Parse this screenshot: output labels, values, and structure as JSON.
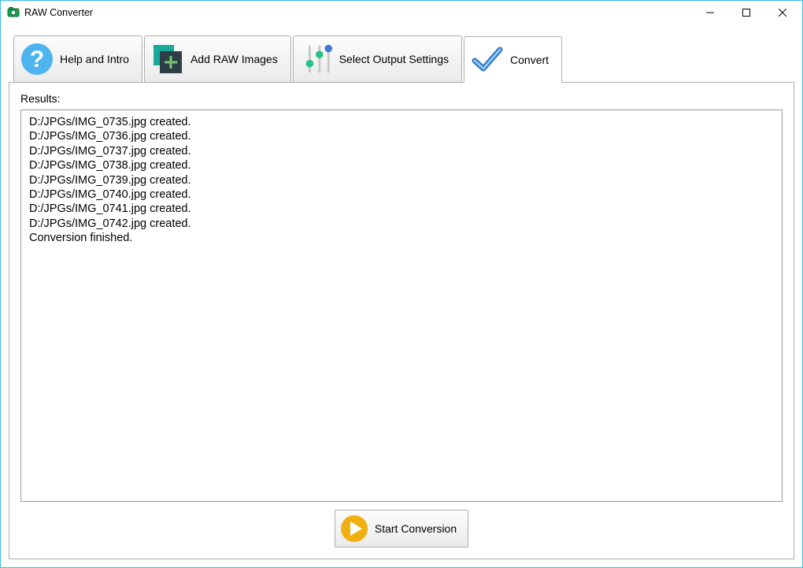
{
  "window": {
    "title": "RAW Converter"
  },
  "tabs": [
    {
      "label": "Help and Intro"
    },
    {
      "label": "Add RAW Images"
    },
    {
      "label": "Select Output Settings"
    },
    {
      "label": "Convert"
    }
  ],
  "results": {
    "label": "Results:",
    "text": "D:/JPGs/IMG_0735.jpg created.\nD:/JPGs/IMG_0736.jpg created.\nD:/JPGs/IMG_0737.jpg created.\nD:/JPGs/IMG_0738.jpg created.\nD:/JPGs/IMG_0739.jpg created.\nD:/JPGs/IMG_0740.jpg created.\nD:/JPGs/IMG_0741.jpg created.\nD:/JPGs/IMG_0742.jpg created.\nConversion finished."
  },
  "start_button": {
    "label": "Start Conversion"
  }
}
